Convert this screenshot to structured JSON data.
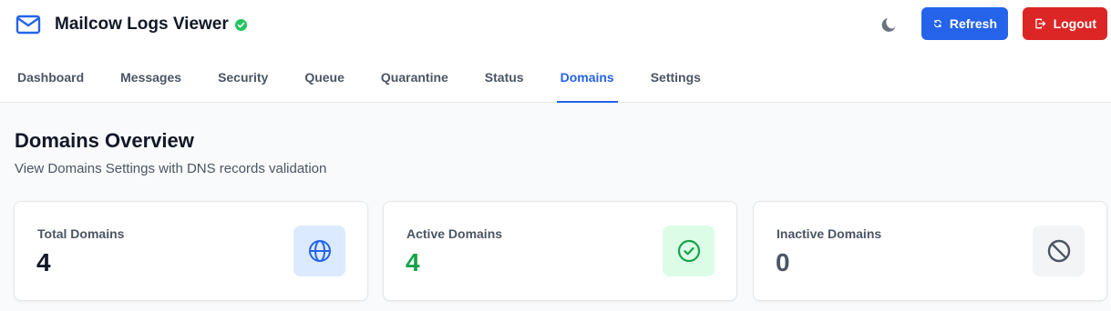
{
  "app": {
    "title": "Mailcow Logs Viewer"
  },
  "header": {
    "refresh_label": "Refresh",
    "logout_label": "Logout"
  },
  "tabs": [
    {
      "label": "Dashboard"
    },
    {
      "label": "Messages"
    },
    {
      "label": "Security"
    },
    {
      "label": "Queue"
    },
    {
      "label": "Quarantine"
    },
    {
      "label": "Status"
    },
    {
      "label": "Domains",
      "active": true
    },
    {
      "label": "Settings"
    }
  ],
  "main": {
    "title": "Domains Overview",
    "subtitle": "View Domains Settings with DNS records validation",
    "cards": [
      {
        "label": "Total Domains",
        "value": "4",
        "icon": "globe-icon",
        "color": "#111827"
      },
      {
        "label": "Active Domains",
        "value": "4",
        "icon": "check-circle-icon",
        "color": "#16a34a"
      },
      {
        "label": "Inactive Domains",
        "value": "0",
        "icon": "ban-icon",
        "color": "#4b5563"
      }
    ]
  },
  "colors": {
    "accent": "#2563eb",
    "danger": "#dc2626",
    "success": "#22c55e"
  }
}
